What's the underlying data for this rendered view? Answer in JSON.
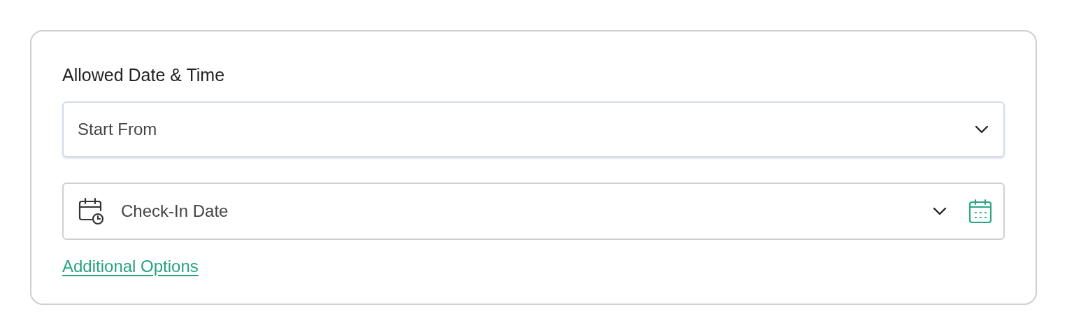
{
  "section": {
    "title": "Allowed Date & Time"
  },
  "start_select": {
    "value": "Start From"
  },
  "date_select": {
    "value": "Check-In Date"
  },
  "link": {
    "label": "Additional Options"
  }
}
